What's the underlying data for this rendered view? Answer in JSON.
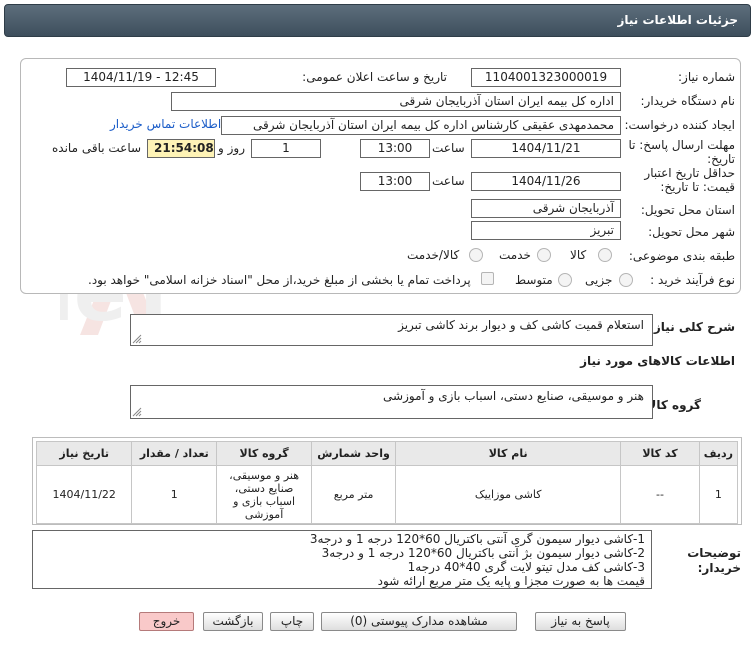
{
  "header": {
    "title": "جزئیات اطلاعات نیاز"
  },
  "watermark": {
    "text": "AriaTender.neT"
  },
  "form": {
    "need_number": {
      "label": "شماره نیاز:",
      "value": "1104001323000019"
    },
    "announce_datetime": {
      "label": "تاریخ و ساعت اعلان عمومی:",
      "value": "1404/11/19 - 12:45"
    },
    "buyer_org": {
      "label": "نام دستگاه خریدار:",
      "value": "اداره کل بیمه ایران استان آذربایجان شرقی"
    },
    "requester": {
      "label": "ایجاد کننده درخواست:",
      "value": "محمدمهدی عقیقی کارشناس اداره کل بیمه ایران استان آذربایجان شرقی",
      "contact_link": "اطلاعات تماس خریدار"
    },
    "reply_deadline": {
      "label_line1": "مهلت ارسال پاسخ: تا",
      "label_line2": "تاریخ:",
      "date": "1404/11/21",
      "time_label": "ساعت",
      "time": "13:00",
      "days": "1",
      "days_label": "روز و",
      "remaining": "21:54:08",
      "remaining_label": "ساعت باقی مانده"
    },
    "price_validity": {
      "label_line1": "حداقل تاریخ اعتبار",
      "label_line2": "قیمت: تا تاریخ:",
      "date": "1404/11/26",
      "time_label": "ساعت",
      "time": "13:00"
    },
    "delivery_province": {
      "label": "استان محل تحویل:",
      "value": "آذربایجان شرقی"
    },
    "delivery_city": {
      "label": "شهر محل تحویل:",
      "value": "تبریز"
    },
    "category": {
      "label": "طبقه بندی موضوعی:",
      "options": [
        "کالا",
        "خدمت",
        "کالا/خدمت"
      ]
    },
    "purchase_type": {
      "label": "نوع فرآیند خرید :",
      "options": [
        "جزیی",
        "متوسط"
      ],
      "note": "پرداخت تمام یا بخشی از مبلغ خرید،از محل \"اسناد خزانه اسلامی\" خواهد بود."
    }
  },
  "summary": {
    "label": "شرح کلی نیاز:",
    "value": "استعلام قمیت کاشی کف و دیوار برند کاشی تبریز"
  },
  "goods_info": {
    "title": "اطلاعات کالاهای مورد نیاز",
    "group_label": "گروه کالا:",
    "group_value": "هنر و موسیقی، صنایع دستی، اسباب بازی و آموزشی"
  },
  "table": {
    "headers": [
      "ردیف",
      "کد کالا",
      "نام کالا",
      "واحد شمارش",
      "گروه کالا",
      "تعداد / مقدار",
      "تاریخ نیاز"
    ],
    "rows": [
      [
        "1",
        "--",
        "کاشی موزاییک",
        "متر مربع",
        "هنر و موسیقی، صنایع دستی، اسباب بازی و آموزشی",
        "1",
        "1404/11/22"
      ]
    ]
  },
  "buyer_notes": {
    "label_line1": "توضیحات",
    "label_line2": "خریدار:",
    "lines": [
      "1-کاشی دیوار سیمون گری آنتی باکتریال 60*120 درجه 1 و درجه3",
      "2-کاشی دیوار سیمون بژ آنتی باکتریال 60*120 درجه 1 و درجه3",
      "3-کاشی کف مدل تیتو لایت گری 40*40 درجه1",
      "قیمت ها به صورت مجزا و پایه یک متر مربع ارائه شود"
    ]
  },
  "buttons": {
    "reply": "پاسخ به نیاز",
    "docs": "مشاهده مدارک پیوستی (0)",
    "print": "چاپ",
    "back": "بازگشت",
    "exit": "خروج"
  }
}
